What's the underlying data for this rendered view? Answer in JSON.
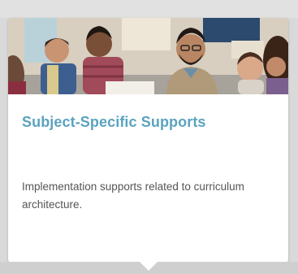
{
  "card": {
    "title": "Subject-Specific Supports",
    "description": "Implementation supports related to curriculum architecture.",
    "image_subject": "teacher-with-students-photo"
  },
  "colors": {
    "title": "#5aa3bf",
    "description": "#555555",
    "card_background": "#ffffff",
    "page_background": "#d9d9d9"
  }
}
